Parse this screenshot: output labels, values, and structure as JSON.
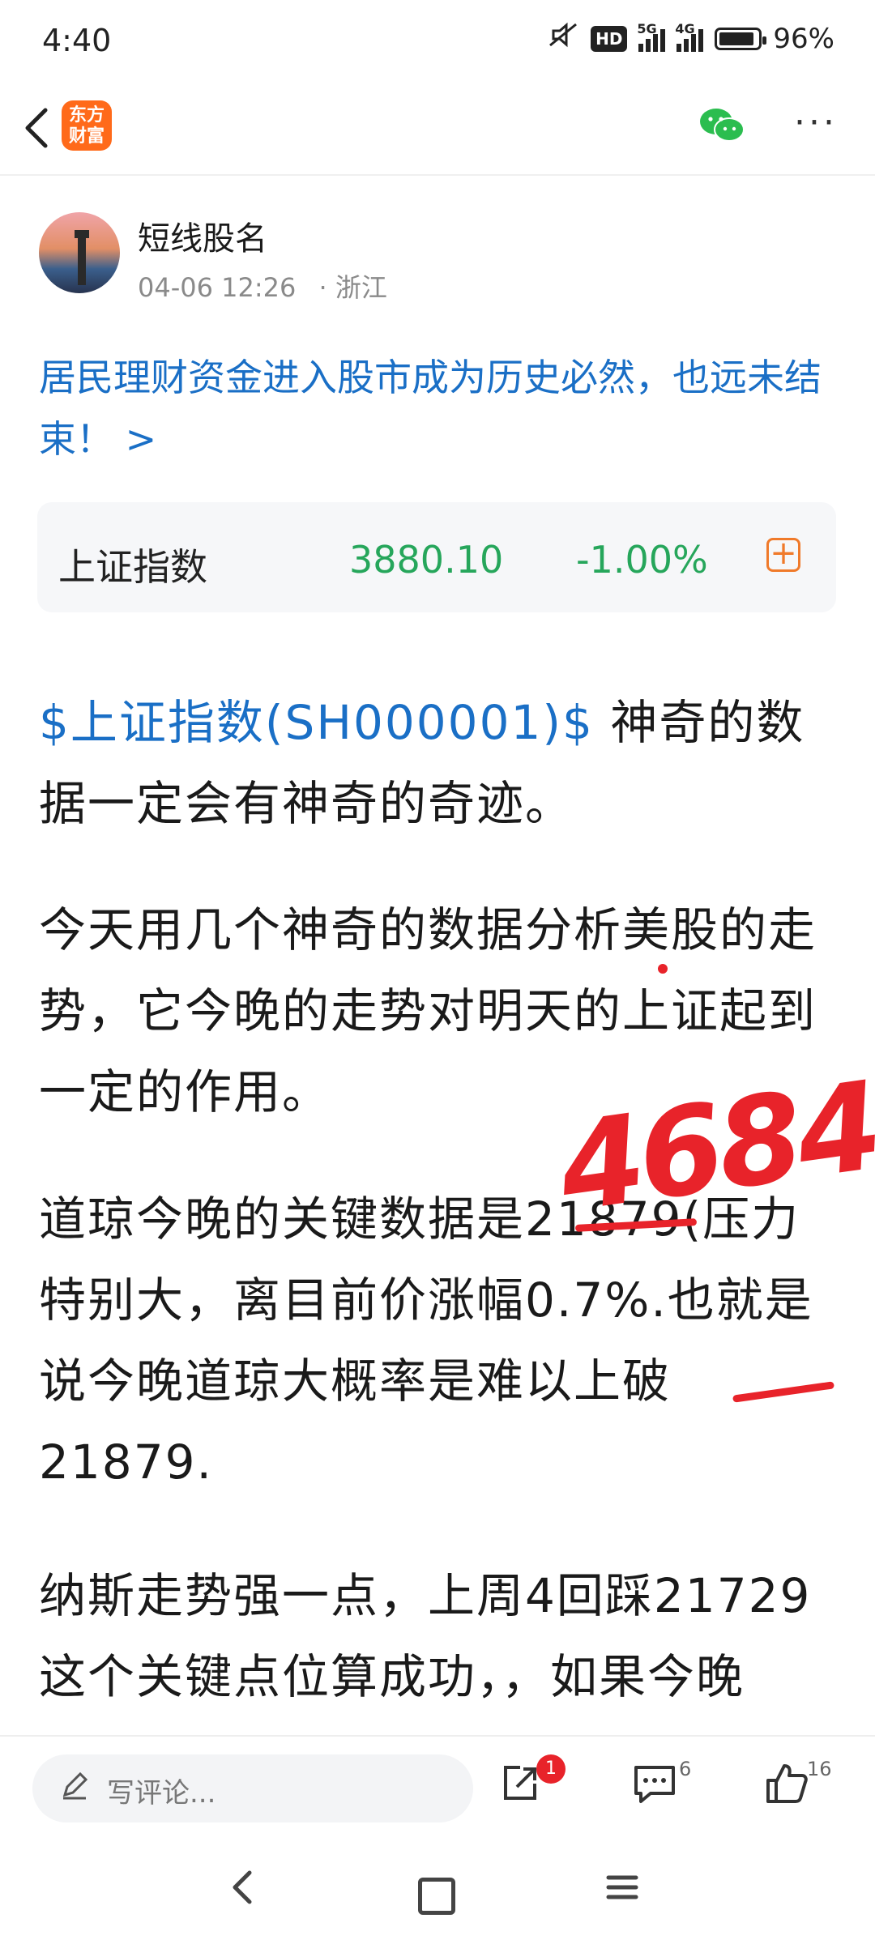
{
  "status_bar": {
    "time": "4:40",
    "hd": "HD",
    "net1": "5G",
    "net2": "4G",
    "battery": "96%"
  },
  "header": {
    "logo_text": "东方财富",
    "logo_color": "#ff6a1a"
  },
  "author": {
    "name": "短线股名",
    "datetime": "04-06 12:26",
    "location": "· 浙江"
  },
  "post_title": "居民理财资金进入股市成为历史必然，也远未结束！ >",
  "stock_card": {
    "name": "上证指数",
    "price": "3880.10",
    "change": "-1.00%",
    "change_color": "#26a65b"
  },
  "body": {
    "p1_link": "$上证指数(SH000001)$",
    "p1_text": " 神奇的数据一定会有神奇的奇迹。",
    "p2": "今天用几个神奇的数据分析美股的走势，它今晚的走势对明天的上证起到一定的作用。",
    "p3": "道琼今晚的关键数据是21879(压力特别大，离目前价涨幅0.7%.也就是说今晚道琼大概率是难以上破21879.",
    "p4": "纳斯走势强一点，上周4回踩21729这个关键点位算成功，，如果今晚"
  },
  "handwriting": {
    "number": "4684"
  },
  "bottom_bar": {
    "comment_placeholder": "写评论...",
    "share_badge": "1",
    "comment_count": "6",
    "like_count": "16"
  }
}
